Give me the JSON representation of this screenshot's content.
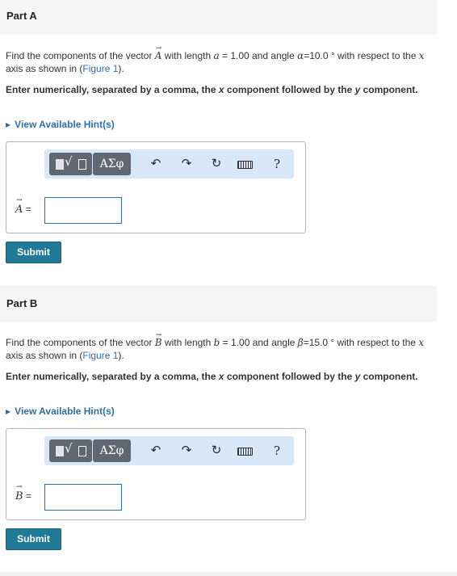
{
  "part_a": {
    "header": "Part A",
    "prompt": {
      "pre": "Find the components of the vector ",
      "vec": "A",
      "mid1": " with length ",
      "len_var": "a",
      "mid2": " = 1.00 and angle ",
      "angle_var": "α",
      "mid3": "=10.0 ° with respect to the ",
      "axis_var": "x",
      "mid4": " axis as shown in (",
      "figure_link": "Figure 1",
      "post": ")."
    },
    "instruction": {
      "pre": "Enter numerically, separated by a comma, the ",
      "x": "x",
      "mid": " component followed by the ",
      "y": "y",
      "post": " component."
    },
    "hint_label": "View Available Hint(s)",
    "answer_label_var": "A",
    "answer_label_eq": "=",
    "answer_value": "",
    "submit_label": "Submit"
  },
  "part_b": {
    "header": "Part B",
    "prompt": {
      "pre": "Find the components of the vector ",
      "vec": "B",
      "mid1": " with length ",
      "len_var": "b",
      "mid2": " = 1.00 and angle ",
      "angle_var": "β",
      "mid3": "=15.0 ° with respect to the ",
      "axis_var": "x",
      "mid4": " axis as shown in (",
      "figure_link": "Figure 1",
      "post": ")."
    },
    "instruction": {
      "pre": "Enter numerically, separated by a comma, the ",
      "x": "x",
      "mid": " component followed by the ",
      "y": "y",
      "post": " component."
    },
    "hint_label": "View Available Hint(s)",
    "answer_label_var": "B",
    "answer_label_eq": "=",
    "answer_value": "",
    "submit_label": "Submit"
  },
  "toolbar": {
    "greek_label": "ΑΣφ",
    "radical_glyph": "√",
    "undo_glyph": "↶",
    "redo_glyph": "↷",
    "reset_glyph": "↻",
    "help_glyph": "?",
    "icons": [
      "template-icon",
      "greek-icon",
      "undo-icon",
      "redo-icon",
      "reset-icon",
      "keyboard-icon",
      "help-icon"
    ]
  },
  "colors": {
    "link": "#2f6fad",
    "submit_bg": "#1e7a97",
    "toolbar_bg": "#d8e8f8",
    "header_bg": "#f5f5f5"
  }
}
